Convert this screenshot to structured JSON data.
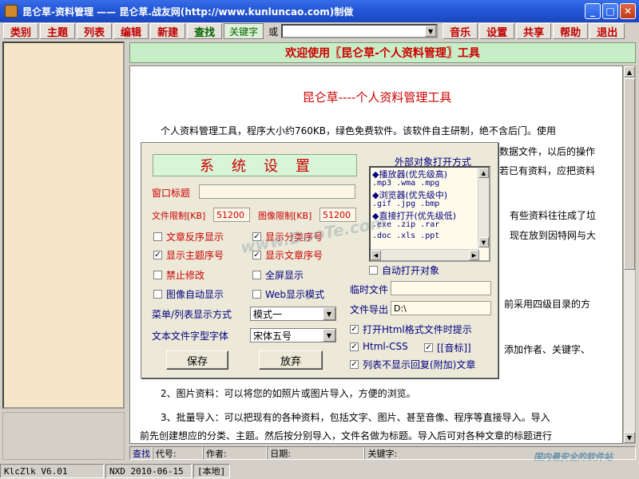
{
  "window": {
    "title": "昆仑草-资料管理 ——  昆仑草.战友网(http://www.kunluncao.com)制做",
    "minimize": "_",
    "maximize": "□",
    "close": "✕"
  },
  "menubar": {
    "items": [
      "类别",
      "主题",
      "列表",
      "编辑",
      "新建"
    ],
    "find": "查找",
    "keyword": "关键字",
    "or": "或",
    "search_value": "",
    "right_items": [
      "音乐",
      "设置",
      "共享",
      "帮助",
      "退出"
    ]
  },
  "main": {
    "header": "欢迎使用〖昆仑草-个人资料管理〗工具",
    "doc_title": "昆仑草----个人资料管理工具",
    "lines": [
      "个人资料管理工具，程序大小约760KB，绿色免费软件。该软件自主研制，绝不含后门。使用",
      "数据文件，以后的操作",
      "若已有资料，应把资料",
      "有些资料往往成了垃",
      "现在放到因特网与大",
      "前采用四级目录的方",
      "添加作者、关键字、",
      "2、图片资料：可以将您的如照片或图片导入，方便的浏览。",
      "3、批量导入：可以把现有的各种资料，包括文字、图片、甚至音像、程序等直接导入。导入",
      "前先创建想应的分类、主题。然后按分别导入，文件名做为标题。导入后可对各种文章的标题进行"
    ]
  },
  "dialog": {
    "title": "系统设置",
    "window_title_label": "窗口标题",
    "window_title_value": "",
    "file_limit_label": "文件限制[KB]",
    "file_limit_value": "51200",
    "image_limit_label": "图像限制[KB]",
    "image_limit_value": "51200",
    "checks": [
      {
        "label": "文章反序显示",
        "checked": false
      },
      {
        "label": "显示分类序号",
        "checked": true
      },
      {
        "label": "显示主题序号",
        "checked": true
      },
      {
        "label": "显示文章序号",
        "checked": true
      },
      {
        "label": "禁止修改",
        "checked": false
      },
      {
        "label": "全屏显示",
        "checked": false
      },
      {
        "label": "图像自动显示",
        "checked": false
      },
      {
        "label": "Web显示模式",
        "checked": false
      }
    ],
    "menu_mode_label": "菜单/列表显示方式",
    "menu_mode_value": "模式一",
    "font_label": "文本文件字型字体",
    "font_value": "宋体五号",
    "save_button": "保存",
    "cancel_button": "放弃",
    "external_title": "外部对象打开方式",
    "external_lines": [
      "◆播放器(优先级高)",
      ".mp3 .wma .mpg",
      "◆浏览器(优先级中)",
      ".gif .jpg .bmp",
      "◆直接打开(优先级低)",
      ".exe .zip .rar",
      ".doc .xls .ppt"
    ],
    "auto_open_label": "自动打开对象",
    "auto_open_checked": false,
    "temp_file_label": "临时文件",
    "temp_file_value": "",
    "export_label": "文件导出",
    "export_value": "D:\\",
    "html_prompt_label": "打开Html格式文件时提示",
    "html_prompt_checked": true,
    "html_css_label": "Html-CSS",
    "html_css_checked": true,
    "music_label": "[[音标]]",
    "music_checked": true,
    "no_reply_label": "列表不显示回复(附加)文章",
    "no_reply_checked": true
  },
  "status": {
    "find": "查找",
    "code": "代号:",
    "author": "作者:",
    "date": "日期:",
    "keyword": "关键字:"
  },
  "bottom": {
    "version": "KlcZlk V6.01",
    "date": "NXD 2010-06-15",
    "location": "[本地]"
  },
  "watermarks": {
    "center": "www.DuoTe.com",
    "corner": "国内最安全的软件站"
  }
}
